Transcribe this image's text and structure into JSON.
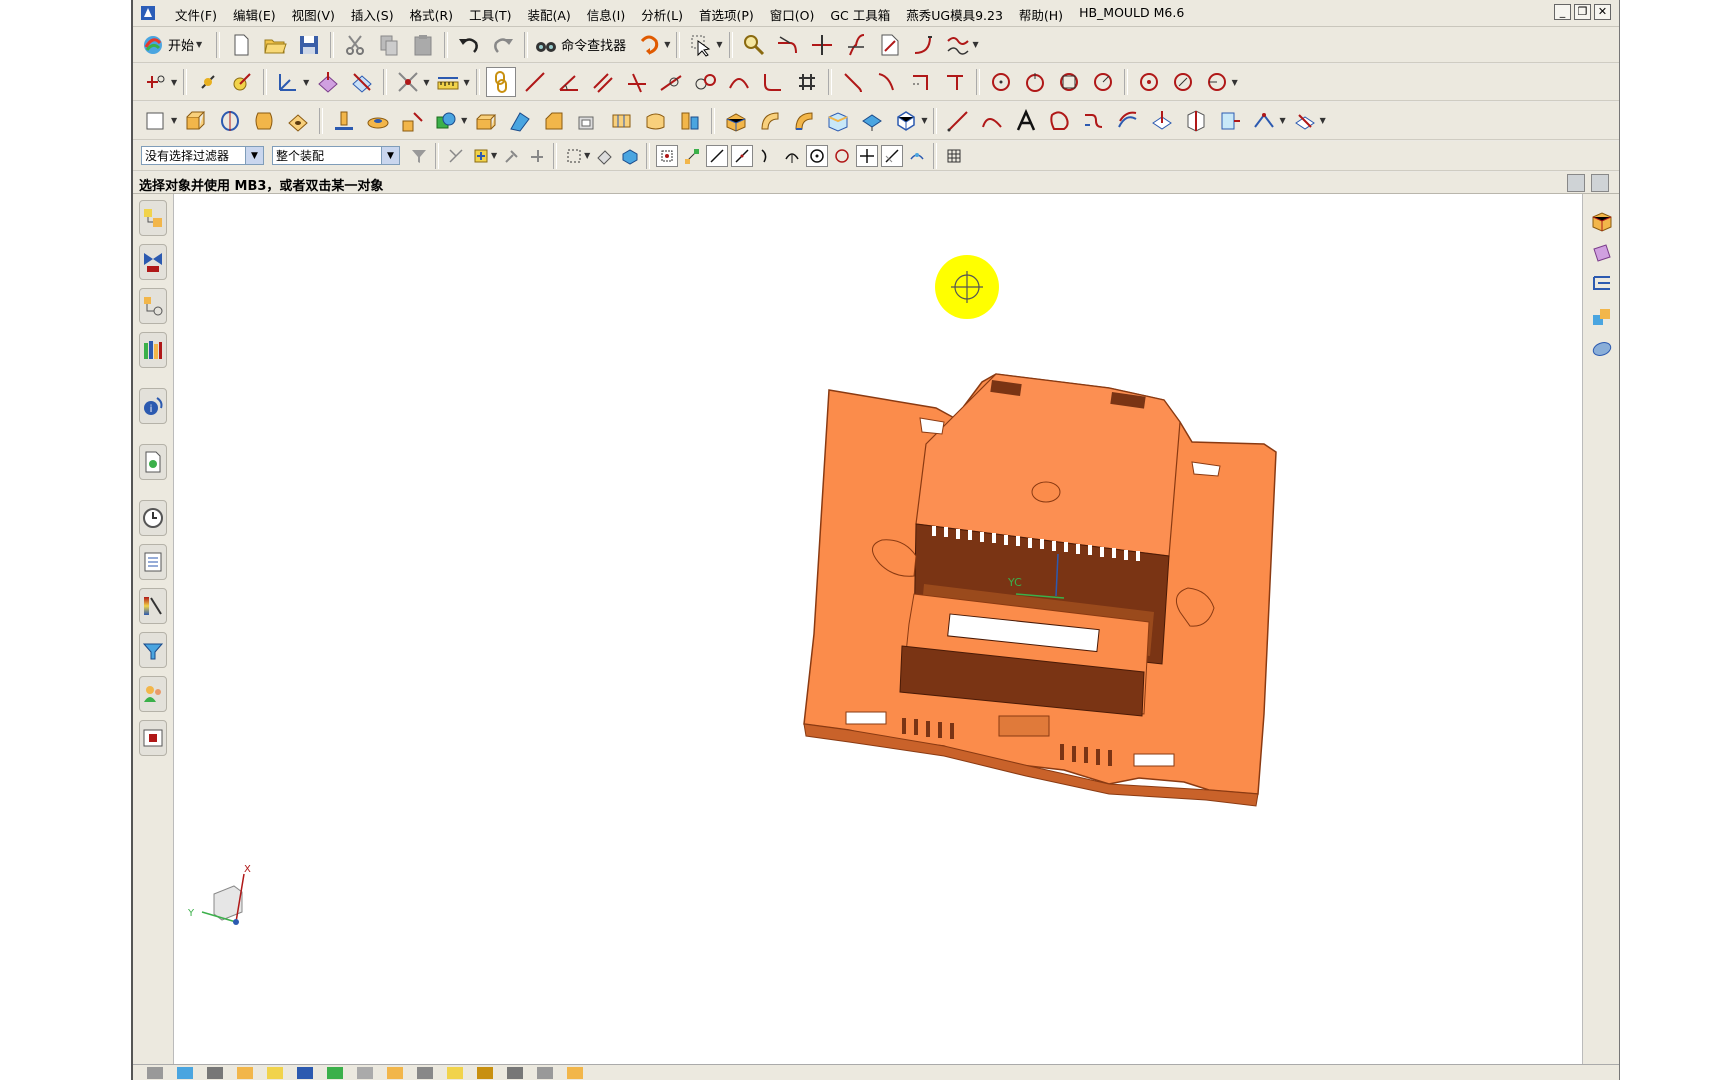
{
  "menu": {
    "items": [
      "文件(F)",
      "编辑(E)",
      "视图(V)",
      "插入(S)",
      "格式(R)",
      "工具(T)",
      "装配(A)",
      "信息(I)",
      "分析(L)",
      "首选项(P)",
      "窗口(O)",
      "GC 工具箱",
      "燕秀UG模具9.23",
      "帮助(H)",
      "HB_MOULD M6.6"
    ]
  },
  "window_controls": {
    "minimize": "_",
    "restore": "❐",
    "close": "✕"
  },
  "toolbar_standard": {
    "start_label": "开始",
    "command_finder_label": "命令查找器"
  },
  "selection_bar": {
    "filter_value": "没有选择过滤器",
    "scope_value": "整个装配"
  },
  "status": {
    "prompt": "选择对象并使用 MB3，或者双击某一对象"
  },
  "viewport": {
    "wcs_label": "YC",
    "triad_x": "X",
    "triad_y": "Y"
  },
  "colors": {
    "part": "#fb8c4b",
    "part_dark": "#7a3414",
    "cursor_highlight": "#ffff00",
    "viewport_bg": "#ffffff"
  }
}
